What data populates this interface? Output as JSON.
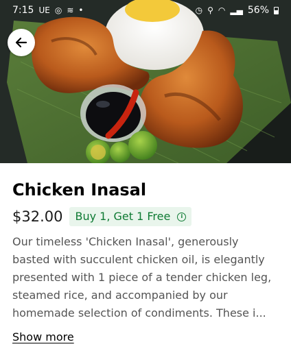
{
  "status_bar": {
    "time": "7:15",
    "left_icons": [
      "ue-icon",
      "instagram-icon",
      "signal-waves-icon",
      "dot-icon"
    ],
    "right_icons": [
      "alarm-icon",
      "location-icon",
      "wifi-icon",
      "cell-signal-icon"
    ],
    "battery": "56%"
  },
  "hero": {
    "image_description": "Chicken Inasal with rice, dipping sauce, chili and calamansi on banana leaf"
  },
  "header": {
    "back_icon": "arrow-left-icon"
  },
  "item": {
    "title": "Chicken Inasal",
    "price": "$32.00",
    "promo_label": "Buy 1, Get 1 Free",
    "promo_icon": "info-icon",
    "description_lines": [
      "Our timeless 'Chicken Inasal', generously",
      "basted with succulent chicken oil, is elegantly",
      "presented with 1 piece of a tender chicken leg,",
      "steamed rice, and accompanied by our",
      "homemade selection of condiments. These i..."
    ],
    "show_more_label": "Show more"
  },
  "colors": {
    "promo_bg": "#e9f5ec",
    "promo_text": "#0e7a33",
    "description_text": "#545454"
  }
}
